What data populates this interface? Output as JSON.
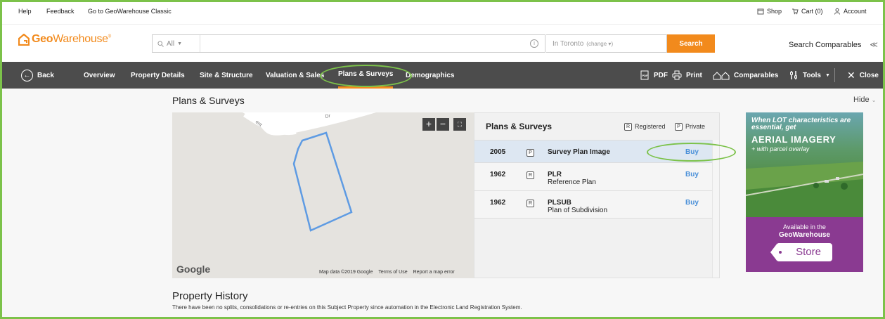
{
  "topbar": {
    "help": "Help",
    "feedback": "Feedback",
    "classic": "Go to GeoWarehouse Classic",
    "shop": "Shop",
    "cart": "Cart (0)",
    "account": "Account"
  },
  "header": {
    "logo_geo": "Geo",
    "logo_warehouse": "Warehouse",
    "logo_mark": "®",
    "search_scope": "All",
    "search_placeholder": "",
    "location_prefix": "In Toronto",
    "location_change": "(change ▾)",
    "search_button": "Search",
    "search_comparables": "Search Comparables"
  },
  "nav": {
    "back": "Back",
    "tabs": [
      "Overview",
      "Property Details",
      "Site & Structure",
      "Valuation & Sales",
      "Plans & Surveys",
      "Demographics"
    ],
    "active_tab": "Plans & Surveys",
    "pdf": "PDF",
    "print": "Print",
    "comparables": "Comparables",
    "tools": "Tools",
    "close": "Close"
  },
  "section": {
    "title": "Plans & Surveys",
    "hide": "Hide"
  },
  "map": {
    "google": "Google",
    "map_data": "Map data ©2019 Google",
    "terms": "Terms of Use",
    "report": "Report a map error"
  },
  "plans": {
    "title": "Plans & Surveys",
    "legend_registered_badge": "R",
    "legend_registered": "Registered",
    "legend_private_badge": "P",
    "legend_private": "Private",
    "rows": [
      {
        "year": "2005",
        "badge": "P",
        "name": "Survey Plan Image",
        "sub": "",
        "action": "Buy"
      },
      {
        "year": "1962",
        "badge": "R",
        "name": "PLR",
        "sub": "Reference Plan",
        "action": "Buy"
      },
      {
        "year": "1962",
        "badge": "R",
        "name": "PLSUB",
        "sub": "Plan of Subdivision",
        "action": "Buy"
      }
    ]
  },
  "ad": {
    "line1": "When LOT characteristics are essential, get",
    "line2": "AERIAL IMAGERY",
    "line3": "+ with parcel overlay",
    "available": "Available in the",
    "brand": "GeoWarehouse",
    "store": "Store"
  },
  "history": {
    "title": "Property History",
    "desc": "There have been no splits, consolidations or re-entries on this Subject Property since automation in the Electronic Land Registration System."
  },
  "colors": {
    "accent_orange": "#f28a1c",
    "nav_bg": "#4c4c4c",
    "link_blue": "#4a90d9",
    "annotation_green": "#7cc24a",
    "ad_purple": "#8a3a91"
  }
}
